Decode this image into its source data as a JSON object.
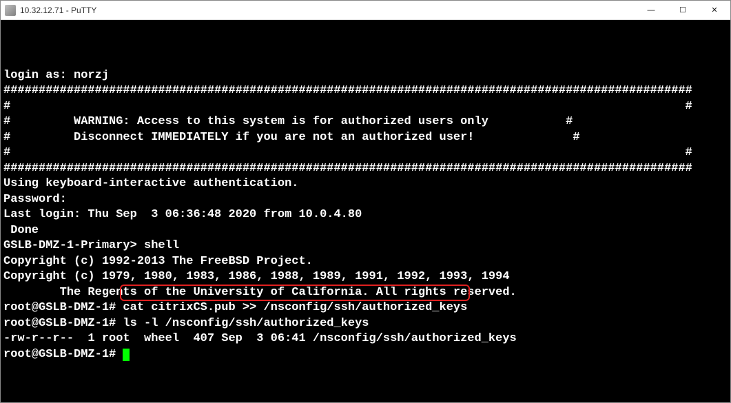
{
  "window": {
    "title": "10.32.12.71 - PuTTY",
    "controls": {
      "minimize": "—",
      "maximize": "☐",
      "close": "✕"
    }
  },
  "terminal": {
    "lines": [
      "login as: norzj",
      "##################################################################################################",
      "#                                                                                                #",
      "#         WARNING: Access to this system is for authorized users only           #",
      "#         Disconnect IMMEDIATELY if you are not an authorized user!              #",
      "#                                                                                                #",
      "##################################################################################################",
      "",
      "Using keyboard-interactive authentication.",
      "Password:",
      "Last login: Thu Sep  3 06:36:48 2020 from 10.0.4.80",
      " Done",
      "GSLB-DMZ-1-Primary> shell",
      "Copyright (c) 1992-2013 The FreeBSD Project.",
      "Copyright (c) 1979, 1980, 1983, 1986, 1988, 1989, 1991, 1992, 1993, 1994",
      "        The Regents of the University of California. All rights reserved.",
      "",
      "root@GSLB-DMZ-1# cat citrixCS.pub >> /nsconfig/ssh/authorized_keys",
      "root@GSLB-DMZ-1# ls -l /nsconfig/ssh/authorized_keys",
      "-rw-r--r--  1 root  wheel  407 Sep  3 06:41 /nsconfig/ssh/authorized_keys",
      "root@GSLB-DMZ-1# "
    ],
    "highlighted_command": "cat citrixCS.pub >> /nsconfig/ssh/authorized_keys",
    "highlight_line_index": 17
  }
}
